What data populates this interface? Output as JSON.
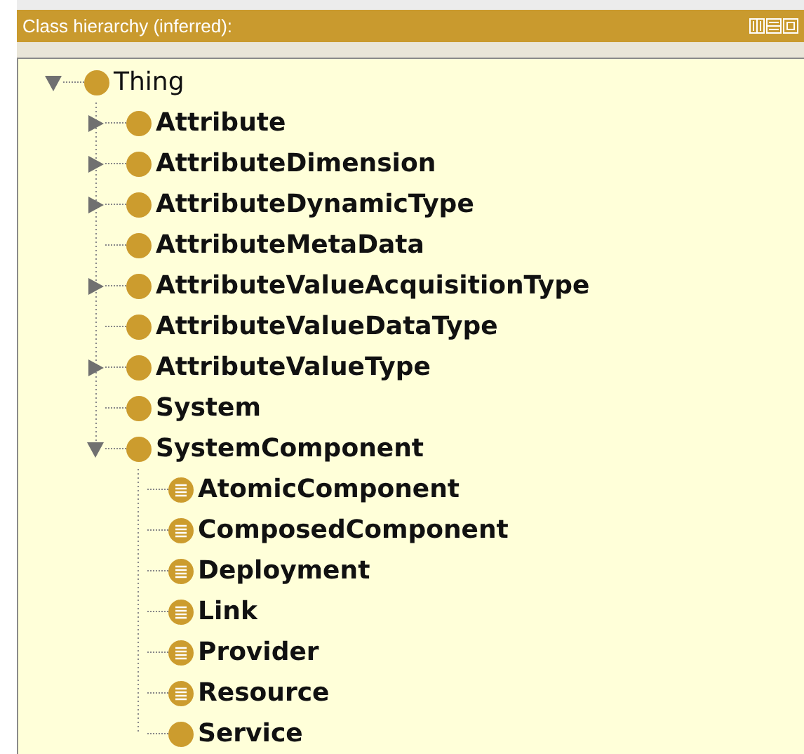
{
  "panel": {
    "title": "Class hierarchy (inferred):"
  },
  "tree": [
    {
      "label": "Thing",
      "kind": "class",
      "expanded": true,
      "children": [
        {
          "label": "Attribute",
          "kind": "class",
          "expanded": false
        },
        {
          "label": "AttributeDimension",
          "kind": "class",
          "expanded": false
        },
        {
          "label": "AttributeDynamicType",
          "kind": "class",
          "expanded": false
        },
        {
          "label": "AttributeMetaData",
          "kind": "class"
        },
        {
          "label": "AttributeValueAcquisitionType",
          "kind": "class",
          "expanded": false
        },
        {
          "label": "AttributeValueDataType",
          "kind": "class"
        },
        {
          "label": "AttributeValueType",
          "kind": "class",
          "expanded": false
        },
        {
          "label": "System",
          "kind": "class"
        },
        {
          "label": "SystemComponent",
          "kind": "class",
          "expanded": true,
          "children": [
            {
              "label": "AtomicComponent",
              "kind": "defined_class"
            },
            {
              "label": "ComposedComponent",
              "kind": "defined_class"
            },
            {
              "label": "Deployment",
              "kind": "defined_class"
            },
            {
              "label": "Link",
              "kind": "defined_class"
            },
            {
              "label": "Provider",
              "kind": "defined_class"
            },
            {
              "label": "Resource",
              "kind": "defined_class"
            },
            {
              "label": "Service",
              "kind": "class"
            }
          ]
        }
      ]
    }
  ]
}
